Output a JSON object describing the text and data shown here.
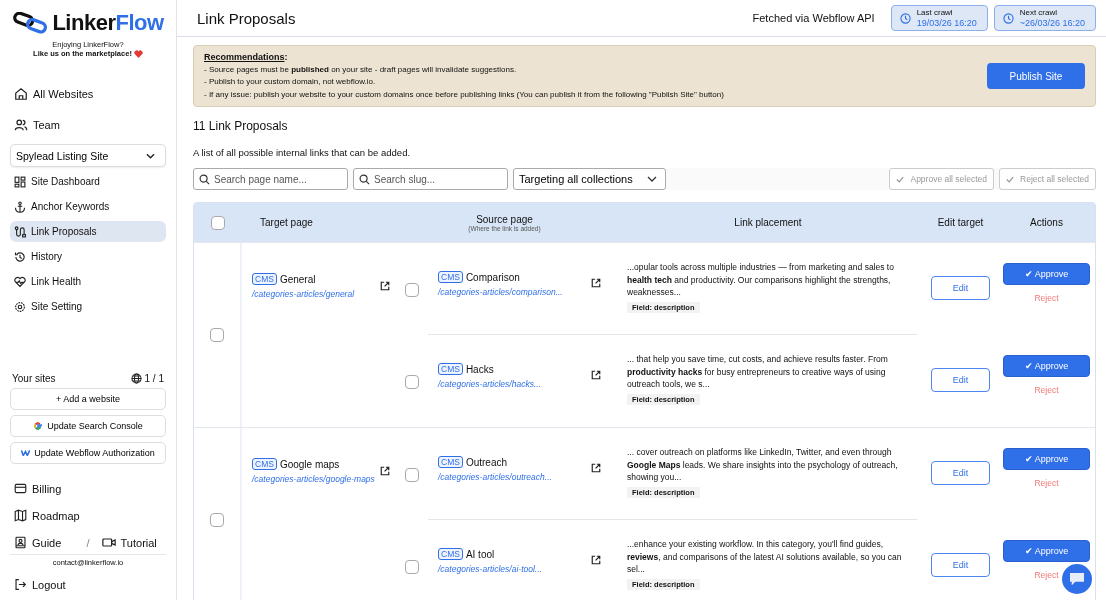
{
  "sidebar": {
    "logo": {
      "part_1": "Linker",
      "part_2": "Flow"
    },
    "promo": [
      "Enjoying LinkerFlow?",
      "Like us on the marketplace!"
    ],
    "top_items": [
      {
        "label": "All Websites"
      },
      {
        "label": "Team"
      }
    ],
    "site_select": {
      "value": "Spylead Listing Site"
    },
    "site_items": [
      {
        "label": "Site Dashboard",
        "selected": false
      },
      {
        "label": "Anchor Keywords",
        "selected": false
      },
      {
        "label": "Link Proposals",
        "selected": true
      },
      {
        "label": "History",
        "selected": false
      },
      {
        "label": "Link Health",
        "selected": false
      },
      {
        "label": "Site Setting",
        "selected": false
      }
    ],
    "your_sites": {
      "label": "Your sites",
      "count": "1 / 1"
    },
    "site_buttons": [
      {
        "label": "+ Add a website",
        "kind": "plain"
      },
      {
        "label": "Update Search Console",
        "kind": "google"
      },
      {
        "label": "Update Webflow Authorization",
        "kind": "webflow"
      }
    ],
    "bottom_items": [
      {
        "label": "Billing"
      },
      {
        "label": "Roadmap"
      }
    ],
    "guide": "Guide",
    "separator": "/",
    "tutorial": "Tutorial",
    "contact": "contact@linkerflow.io",
    "logout": "Logout"
  },
  "header": {
    "title": "Link Proposals",
    "fetched": "Fetched via Webflow API",
    "crawls": [
      {
        "label": "Last crawl",
        "date": "19/03/26 16:20"
      },
      {
        "label": "Next crawl",
        "date": "~26/03/26 16:20"
      }
    ]
  },
  "banner": {
    "heading": "Recommendations",
    "colon": ":",
    "lines": [
      "- Source pages must be **published** on your site - draft pages will invalidate suggestions.",
      "- Publish to your custom domain, not webflow.io.",
      "- If any issue: publish your website to your custom domains once before publishing links (You can publish it from the following \"Publish Site\" button)"
    ],
    "button": "Publish Site"
  },
  "count_title": "11 Link Proposals",
  "description": "A list of all possible internal links that can be added.",
  "filters": {
    "search_page": {
      "placeholder": "Search page name..."
    },
    "search_slug": {
      "placeholder": "Search slug..."
    },
    "collection": "Targeting all collections",
    "approve_all": "Approve all selected",
    "reject_all": "Reject all selected"
  },
  "table": {
    "columns": [
      "Target page",
      "Source page",
      "Link placement",
      "Edit target",
      "Actions"
    ],
    "source_hint": "(Where the link is added)",
    "all_selected": false,
    "groups": [
      {
        "selected": false,
        "target": {
          "badge": "CMS",
          "title": "General",
          "slug": "/categories-articles/general"
        },
        "sources": [
          {
            "selected": false,
            "badge": "CMS",
            "title": "Comparison",
            "slug": "/categories-articles/comparison...",
            "snippet": "...opular tools across multiple industries — from marketing and sales to **health tech** and productivity. Our comparisons highlight the strengths, weaknesses...",
            "field": "Field: description",
            "edit": "Edit",
            "approve": "✔ Approve",
            "reject": "Reject"
          },
          {
            "selected": false,
            "badge": "CMS",
            "title": "Hacks",
            "slug": "/categories-articles/hacks...",
            "snippet": "... that help you save time, cut costs, and achieve results faster. From **productivity hacks** for busy entrepreneurs to creative ways of using outreach tools, we s...",
            "field": "Field: description",
            "edit": "Edit",
            "approve": "✔ Approve",
            "reject": "Reject"
          }
        ]
      },
      {
        "selected": false,
        "target": {
          "badge": "CMS",
          "title": "Google maps",
          "slug": "/categories-articles/google-maps"
        },
        "sources": [
          {
            "selected": false,
            "badge": "CMS",
            "title": "Outreach",
            "slug": "/categories-articles/outreach...",
            "snippet": "... cover outreach on platforms like LinkedIn, Twitter, and even through **Google Maps** leads. We share insights into the psychology of outreach, showing you...",
            "field": "Field: description",
            "edit": "Edit",
            "approve": "✔ Approve",
            "reject": "Reject"
          },
          {
            "selected": false,
            "badge": "CMS",
            "title": "AI tool",
            "slug": "/categories-articles/ai-tool...",
            "snippet": "...enhance your existing workflow. In this category, you'll find guides, **reviews**, and comparisons of the latest AI solutions available, so you can sel...",
            "field": "Field: description",
            "edit": "Edit",
            "approve": "✔ Approve",
            "reject": "Reject"
          }
        ]
      }
    ]
  }
}
